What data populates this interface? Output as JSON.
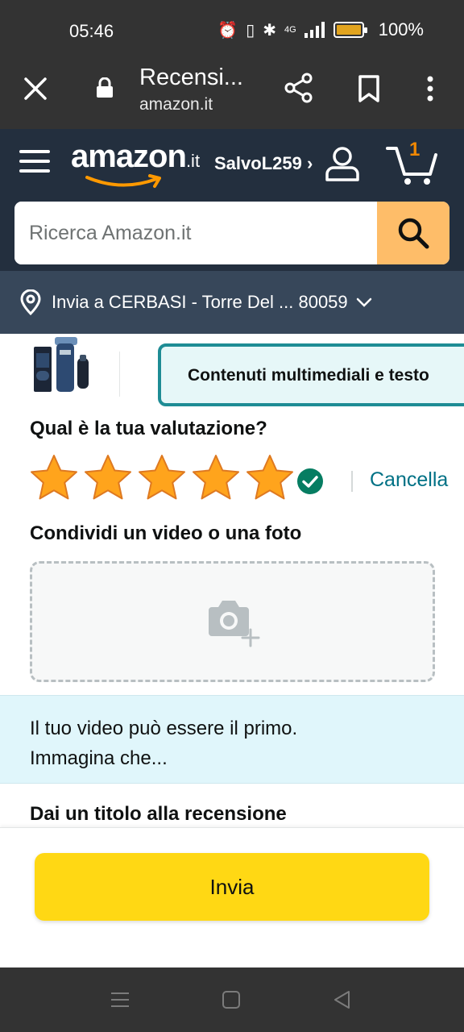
{
  "status_bar": {
    "time": "05:46",
    "network": "4G",
    "battery": "100%"
  },
  "browser": {
    "tab_title": "Recensi...",
    "url": "amazon.it"
  },
  "header": {
    "logo_text": "amazon",
    "logo_tld": ".it",
    "user_name": "SalvoL259 ›",
    "cart_count": "1",
    "search_placeholder": "Ricerca Amazon.it"
  },
  "delivery": {
    "text": "Invia a CERBASI - Torre Del ... 80059"
  },
  "media_tab": {
    "label": "Contenuti multimediali e testo"
  },
  "rating": {
    "question": "Qual è la tua valutazione?",
    "value": 5,
    "max": 5,
    "cancel_label": "Cancella"
  },
  "upload": {
    "heading": "Condividi un video o una foto"
  },
  "info": {
    "line1": "Il tuo video può essere il primo.",
    "line2": "Immagina che..."
  },
  "review_title": {
    "heading": "Dai un titolo alla recensione"
  },
  "submit": {
    "label": "Invia"
  },
  "colors": {
    "header_bg": "#232f3e",
    "delivery_bg": "#37475a",
    "search_button": "#febd69",
    "star": "#ffa41c",
    "link": "#007185",
    "submit_button": "#ffd814",
    "check": "#067d62",
    "info_bg": "#e0f6fb"
  },
  "icons": {
    "close": "close-icon",
    "lock": "lock-icon",
    "share": "share-icon",
    "bookmark": "bookmark-icon",
    "menu": "more-vert-icon",
    "hamburger": "hamburger-icon",
    "user": "user-icon",
    "cart": "cart-icon",
    "search": "search-icon",
    "pin": "location-pin-icon",
    "camera": "camera-add-icon",
    "check": "check-circle-icon"
  }
}
